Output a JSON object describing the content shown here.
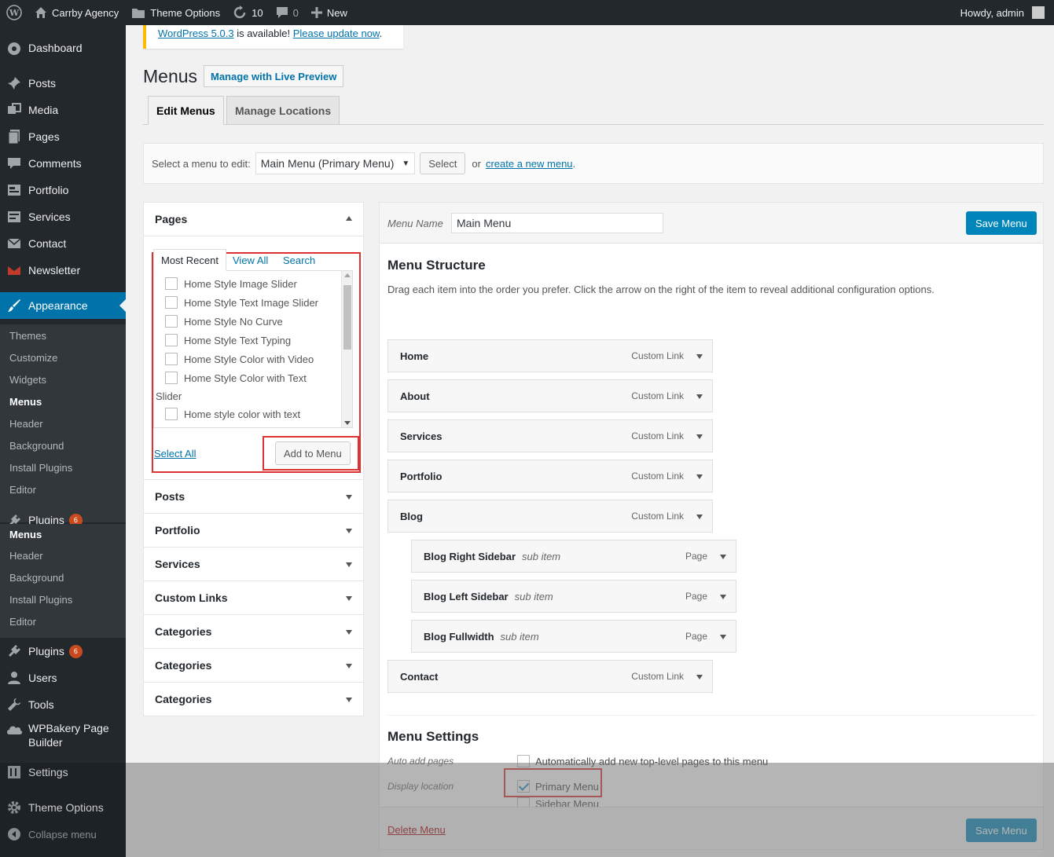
{
  "adminbar": {
    "site_name": "Carrby Agency",
    "theme_options": "Theme Options",
    "updates_count": "10",
    "comments_count": "0",
    "new_label": "New",
    "greeting": "Howdy, admin"
  },
  "sidebar": {
    "dashboard": "Dashboard",
    "posts": "Posts",
    "media": "Media",
    "pages": "Pages",
    "comments": "Comments",
    "portfolio": "Portfolio",
    "services": "Services",
    "contact": "Contact",
    "newsletter": "Newsletter",
    "appearance": "Appearance",
    "appearance_sub": [
      "Themes",
      "Customize",
      "Widgets",
      "Menus",
      "Header",
      "Background",
      "Install Plugins",
      "Editor"
    ],
    "plugins": "Plugins",
    "plugins_badge": "6",
    "dup_sub": [
      "Menus",
      "Header",
      "Background",
      "Install Plugins",
      "Editor"
    ],
    "users": "Users",
    "tools": "Tools",
    "wpbakery": "WPBakery Page Builder",
    "settings": "Settings",
    "theme_options": "Theme Options",
    "collapse": "Collapse menu"
  },
  "notice": {
    "link1": "WordPress 5.0.3",
    "text": " is available! ",
    "link2": "Please update now",
    "end": "."
  },
  "header": {
    "title": "Menus",
    "live_preview": "Manage with Live Preview"
  },
  "tabs": {
    "edit": "Edit Menus",
    "locations": "Manage Locations"
  },
  "manage": {
    "label": "Select a menu to edit:",
    "selected": "Main Menu (Primary Menu)",
    "select_btn": "Select",
    "or": "or",
    "create_link": "create a new menu",
    "period": "."
  },
  "left": {
    "pages_title": "Pages",
    "subtabs": [
      "Most Recent",
      "View All",
      "Search"
    ],
    "pages": [
      "Home Style Image Slider",
      "Home Style Text Image Slider",
      "Home Style No Curve",
      "Home Style Text Typing",
      "Home Style Color with Video",
      "Home Style Color with Text"
    ],
    "wrap_text": "Slider",
    "last_page": "Home style color with text",
    "select_all": "Select All",
    "add_to_menu": "Add to Menu",
    "sections": [
      "Posts",
      "Portfolio",
      "Services",
      "Custom Links",
      "Categories",
      "Categories",
      "Categories"
    ]
  },
  "right": {
    "menu_name_label": "Menu Name",
    "menu_name_value": "Main Menu",
    "save": "Save Menu",
    "structure_title": "Menu Structure",
    "structure_desc": "Drag each item into the order you prefer. Click the arrow on the right of the item to reveal additional configuration options.",
    "items": [
      {
        "title": "Home",
        "type": "Custom Link"
      },
      {
        "title": "About",
        "type": "Custom Link"
      },
      {
        "title": "Services",
        "type": "Custom Link"
      },
      {
        "title": "Portfolio",
        "type": "Custom Link"
      },
      {
        "title": "Blog",
        "type": "Custom Link"
      }
    ],
    "sub_items": [
      {
        "title": "Blog Right Sidebar",
        "tag": "sub item",
        "type": "Page"
      },
      {
        "title": "Blog Left Sidebar",
        "tag": "sub item",
        "type": "Page"
      },
      {
        "title": "Blog Fullwidth",
        "tag": "sub item",
        "type": "Page"
      }
    ],
    "last_item": {
      "title": "Contact",
      "type": "Custom Link"
    },
    "settings_title": "Menu Settings",
    "auto_add_label": "Auto add pages",
    "auto_add_text": "Automatically add new top-level pages to this menu",
    "display_label": "Display location",
    "primary_menu": "Primary Menu",
    "sidebar_menu": "Sidebar Menu",
    "delete": "Delete Menu"
  }
}
